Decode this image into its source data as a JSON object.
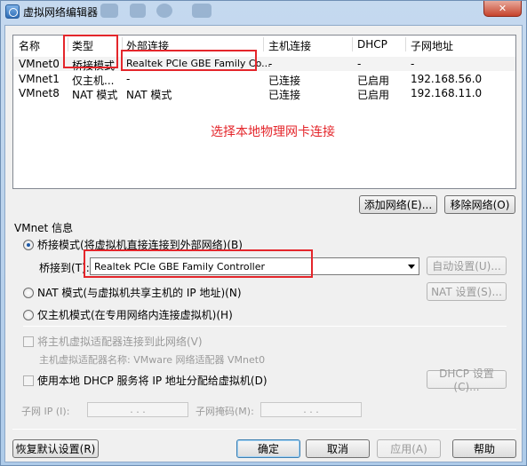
{
  "window": {
    "title": "虚拟网络编辑器",
    "close_label": "✕"
  },
  "table": {
    "headers": [
      "名称",
      "类型",
      "外部连接",
      "主机连接",
      "DHCP",
      "子网地址"
    ],
    "rows": [
      [
        "VMnet0",
        "桥接模式",
        "Realtek PCIe GBE Family Co...",
        "-",
        "-",
        "-"
      ],
      [
        "VMnet1",
        "仅主机...",
        "-",
        "已连接",
        "已启用",
        "192.168.56.0"
      ],
      [
        "VMnet8",
        "NAT 模式",
        "NAT 模式",
        "已连接",
        "已启用",
        "192.168.11.0"
      ]
    ],
    "annotation": "选择本地物理网卡连接"
  },
  "buttons": {
    "add_network": "添加网络(E)...",
    "remove_network": "移除网络(O)",
    "auto_settings": "自动设置(U)...",
    "nat_settings": "NAT 设置(S)...",
    "dhcp_settings": "DHCP 设置(C)...",
    "restore_defaults": "恢复默认设置(R)",
    "ok": "确定",
    "cancel": "取消",
    "apply": "应用(A)",
    "help": "帮助"
  },
  "vmnet_info": {
    "group_label": "VMnet 信息",
    "bridged_radio": "桥接模式(将虚拟机直接连接到外部网络)(B)",
    "bridge_to_label": "桥接到(T):",
    "bridge_to_value": "Realtek PCIe GBE Family Controller",
    "nat_radio": "NAT 模式(与虚拟机共享主机的 IP 地址)(N)",
    "hostonly_radio": "仅主机模式(在专用网络内连接虚拟机)(H)",
    "connect_adapter_check": "将主机虚拟适配器连接到此网络(V)",
    "adapter_name_label": "主机虚拟适配器名称: VMware 网络适配器 VMnet0",
    "use_dhcp_check": "使用本地 DHCP 服务将 IP 地址分配给虚拟机(D)",
    "subnet_ip_label": "子网 IP (I):",
    "subnet_mask_label": "子网掩码(M):",
    "ip_dots": ". . ."
  }
}
